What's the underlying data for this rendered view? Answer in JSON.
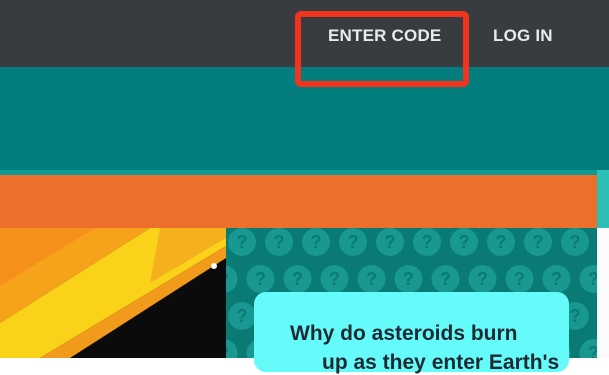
{
  "nav": {
    "enter_code": "ENTER CODE",
    "log_in": "LOG IN"
  },
  "question_card": {
    "line1": "Why do asteroids burn",
    "line2": "up as they enter Earth's"
  },
  "colors": {
    "topbar": "#383b40",
    "teal": "#037d7d",
    "orange": "#ee6f2c",
    "highlight": "#f2341e",
    "card": "#66fbfb"
  },
  "icons": {
    "pattern": "question-mark-icon"
  }
}
